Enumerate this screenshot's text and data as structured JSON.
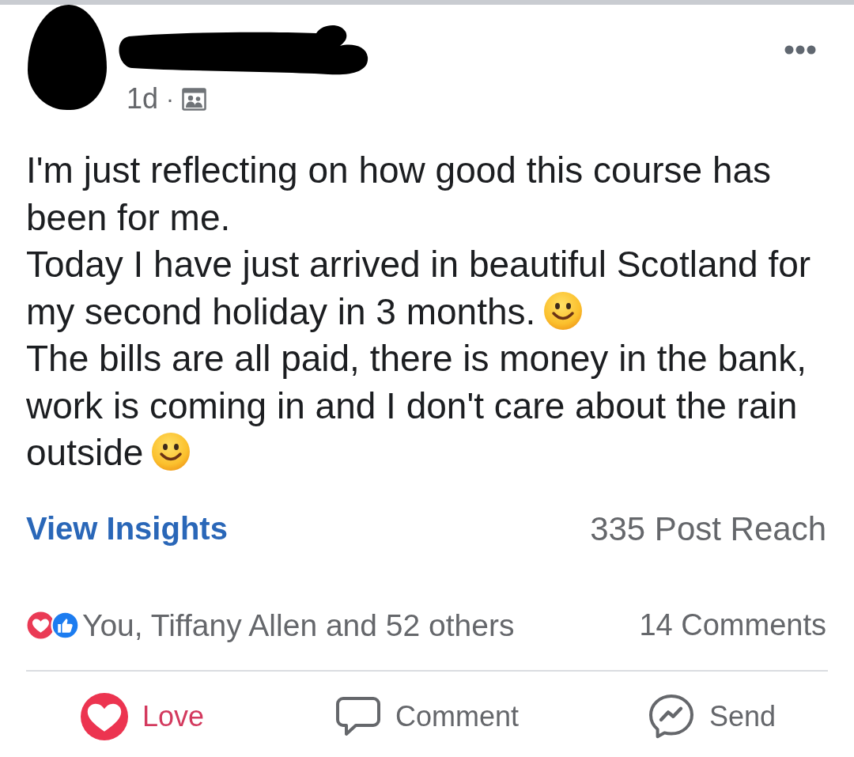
{
  "header": {
    "time": "1d",
    "separator": "·"
  },
  "post": {
    "paragraphs": [
      {
        "text": "I'm just reflecting on how good this course has been for me.",
        "emoji_after": false
      },
      {
        "text": "Today I have just arrived in beautiful Scotland for my second holiday in 3 months.",
        "emoji_after": true
      },
      {
        "text": "The bills are all paid, there is money in the bank, work is coming in and I don't care about the rain outside",
        "emoji_after": true
      }
    ]
  },
  "insights": {
    "link": "View Insights",
    "reach": "335 Post Reach"
  },
  "reactions": {
    "summary": "You, Tiffany Allen and 52 others",
    "comments": "14 Comments"
  },
  "actions": [
    {
      "kind": "love",
      "label": "Love",
      "selected": true
    },
    {
      "kind": "comment",
      "label": "Comment",
      "selected": false
    },
    {
      "kind": "send",
      "label": "Send",
      "selected": false
    }
  ]
}
